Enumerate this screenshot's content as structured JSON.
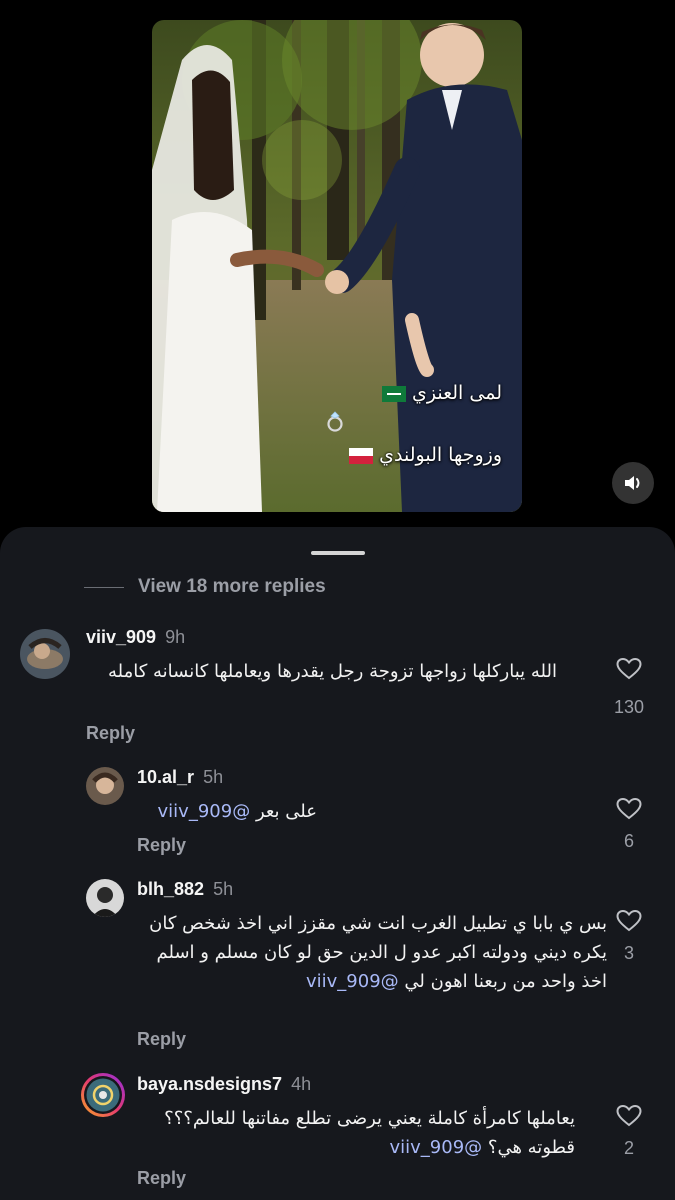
{
  "video": {
    "overlay_line1": "لمى العنزي",
    "overlay_line2": "وزوجها البولندي",
    "volume_icon": "speaker-icon"
  },
  "comments_sheet": {
    "view_more": "View 18 more replies",
    "comments": [
      {
        "username": "viiv_909",
        "time": "9h",
        "text": "الله يباركلها زواجها تزوجة رجل يقدرها ويعاملها كانسانه كامله",
        "likes": "130",
        "reply_label": "Reply"
      },
      {
        "username": "10.al_r",
        "time": "5h",
        "mention": "@viiv_909",
        "text": "على بعر",
        "likes": "6",
        "reply_label": "Reply"
      },
      {
        "username": "blh_882",
        "time": "5h",
        "mention": "@viiv_909",
        "text": "بس ي بابا ي تطبيل الغرب انت شي مقزز اني اخذ شخص كان يكره ديني ودولته اكبر عدو ل الدين حق لو كان مسلم و اسلم اخذ واحد من ربعنا اهون لي",
        "likes": "3",
        "reply_label": "Reply"
      },
      {
        "username": "baya.nsdesigns7",
        "time": "4h",
        "mention": "@viiv_909",
        "text": "يعاملها كامرأة كاملة يعني يرضى تطلع مفاتنها للعالم؟؟؟ قطوته هي؟",
        "likes": "2",
        "reply_label": "Reply"
      }
    ]
  },
  "colors": {
    "sheet_bg": "#16181d",
    "mention": "#a9b9f7",
    "secondary_text": "#9b9ea6"
  }
}
